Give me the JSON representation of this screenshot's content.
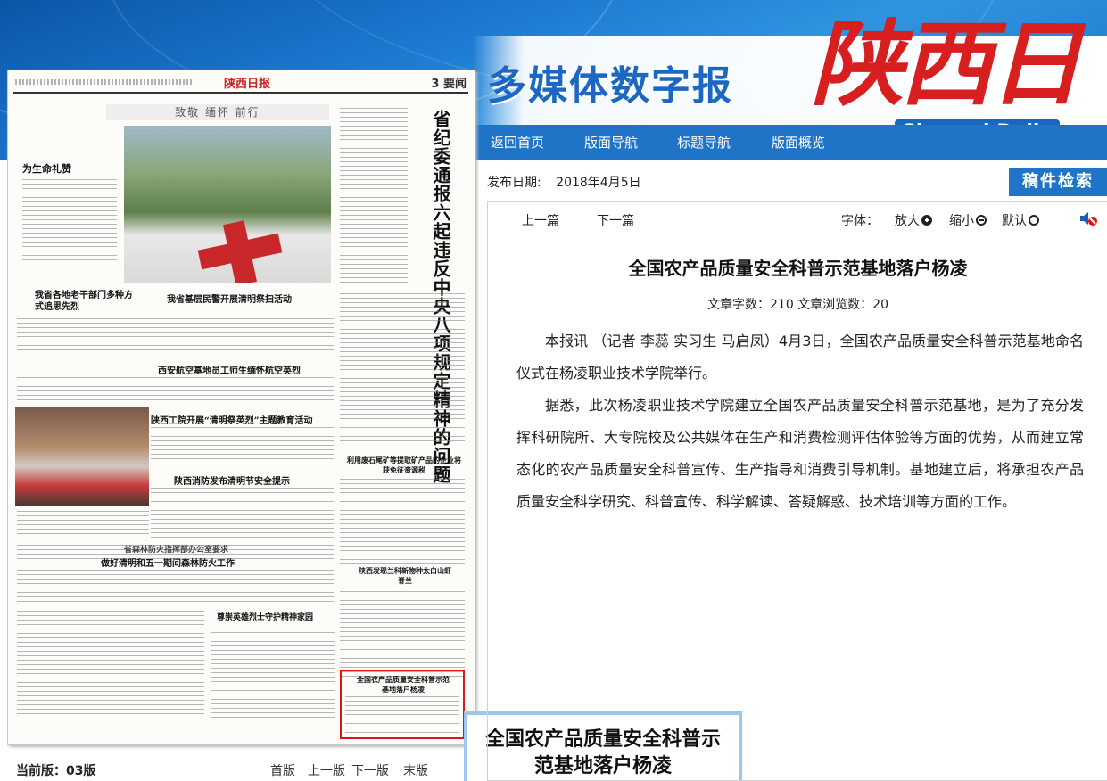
{
  "header": {
    "site_title": "多媒体数字报",
    "brand_cn": "陕西日报",
    "brand_en": "Shaanxi Daily",
    "nav": [
      "返回首页",
      "版面导航",
      "标题导航",
      "版面概览"
    ]
  },
  "paper": {
    "logo_text": "陕西日报",
    "page_label": "3  要闻",
    "sub_banner": "致敬  缅怀  前行",
    "vertical_title": "省纪委通报六起违反中央八项规定精神的问题",
    "headlines": [
      "为生命礼赞",
      "我省各地老干部门多种方式追思先烈",
      "我省基层民警开展清明祭扫活动",
      "西安航空基地员工师生缅怀航空英烈",
      "陕西工院开展“清明祭英烈”主题教育活动",
      "陕西消防发布清明节安全提示",
      "省森林防火指挥部办公室要求",
      "做好清明和五一期间森林防火工作",
      "尊崇英雄烈士守护精神家园",
      "利用废石尾矿等提取矿产品的企业将获免征资源税",
      "陕西发现兰科新物种太白山虾脊兰",
      "全国农产品质量安全科普示范基地落户杨凌"
    ]
  },
  "page_nav": {
    "current": "当前版：03版",
    "links": [
      "首版",
      "上一版",
      "下一版",
      "末版"
    ]
  },
  "popup": {
    "text": "全国农产品质量安全科普示范基地落户杨凌"
  },
  "meta": {
    "date_label": "发布日期:",
    "date_value": "2018年4月5日",
    "search_label": "稿件检索"
  },
  "toolbar": {
    "prev": "上一篇",
    "next": "下一篇",
    "font_label": "字体：",
    "bigger": "放大",
    "smaller": "缩小",
    "default": "默认"
  },
  "article": {
    "title": "全国农产品质量安全科普示范基地落户杨凌",
    "stats": "文章字数：210   文章浏览数：20",
    "paragraphs": [
      "本报讯 （记者 李蕊 实习生 马启凤）4月3日，全国农产品质量安全科普示范基地命名仪式在杨凌职业技术学院举行。",
      "据悉，此次杨凌职业技术学院建立全国农产品质量安全科普示范基地，是为了充分发挥科研院所、大专院校及公共媒体在生产和消费检测评估体验等方面的优势，从而建立常态化的农产品质量安全科普宣传、生产指导和消费引导机制。基地建立后，将承担农产品质量安全科学研究、科普宣传、科学解读、答疑解惑、技术培训等方面的工作。"
    ]
  },
  "colors": {
    "header_blue": "#1f74c8",
    "brand_red": "#d81f1f",
    "highlight_red": "#e01414"
  }
}
